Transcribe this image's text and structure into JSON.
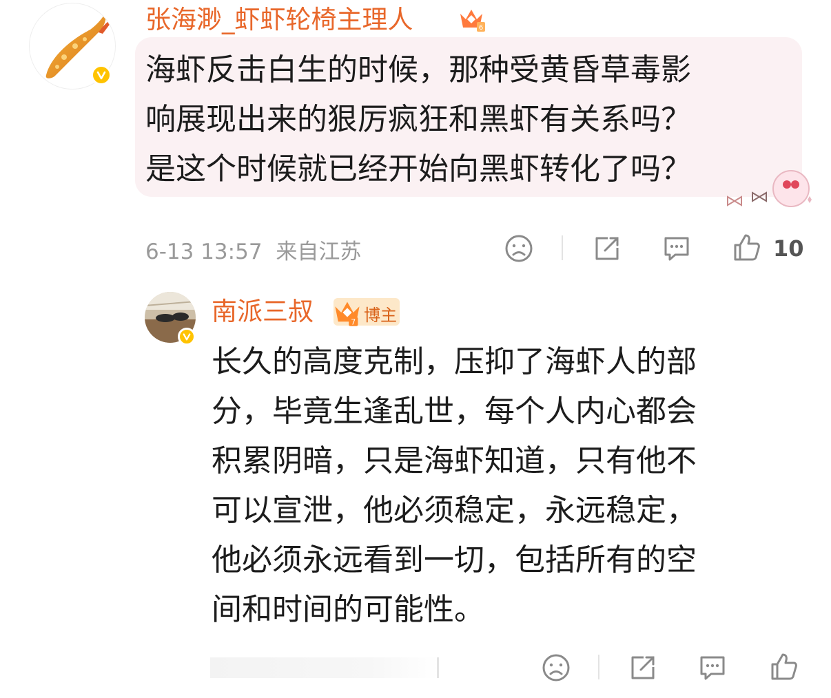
{
  "comment": {
    "author": "张海渺_虾虾轮椅主理人",
    "crown_level": "6",
    "lines": [
      "海虾反击白生的时候，那种受黄昏草毒影",
      "响展现出来的狠厉疯狂和黑虾有关系吗？",
      "是这个时候就已经开始向黑虾转化了吗？"
    ],
    "timestamp": "6-13 13:57",
    "location": "来自江苏",
    "like_count": "10"
  },
  "reply": {
    "author": "南派三叔",
    "crown_level": "7",
    "badge": "博主",
    "lines": [
      "长久的高度克制，压抑了海虾人的部",
      "分，毕竟生逢乱世，每个人内心都会",
      "积累阴暗，只是海虾知道，只有他不",
      "可以宣泄，他必须稳定，永远稳定，",
      "他必须永远看到一切，包括所有的空",
      "间和时间的可能性。"
    ]
  },
  "icons": {
    "dislike": "sad-face-icon",
    "share": "share-icon",
    "comment": "comment-icon",
    "like": "thumbs-up-icon",
    "verified": "verified-v-icon",
    "crown": "crown-icon"
  },
  "colors": {
    "username": "#e8672a",
    "verified_badge": "#ffc300",
    "bubble_bg": "#fbf1f3",
    "meta_text": "#9a9a9a",
    "icon_gray": "#8a8a8a"
  }
}
